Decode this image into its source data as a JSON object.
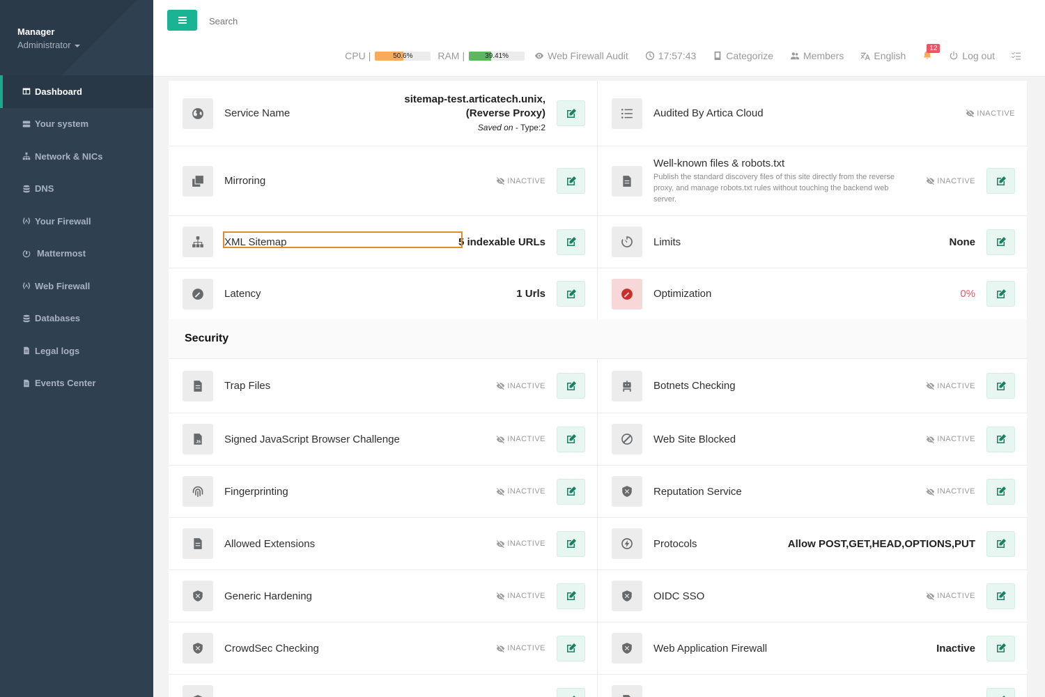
{
  "sidebar": {
    "user_name": "Manager",
    "user_role": "Administrator",
    "items": [
      {
        "label": "Dashboard",
        "icon": "dashboard-icon"
      },
      {
        "label": "Your system",
        "icon": "server-icon"
      },
      {
        "label": "Network & NICs",
        "icon": "network-icon"
      },
      {
        "label": "DNS",
        "icon": "database-icon"
      },
      {
        "label": "Your Firewall",
        "icon": "firewall-icon"
      },
      {
        "label": "Mattermost",
        "icon": "mattermost-icon"
      },
      {
        "label": "Web Firewall",
        "icon": "firewall-icon"
      },
      {
        "label": "Databases",
        "icon": "database-icon"
      },
      {
        "label": "Legal logs",
        "icon": "file-icon"
      },
      {
        "label": "Events Center",
        "icon": "file-icon"
      }
    ]
  },
  "header": {
    "search_placeholder": "Search",
    "cpu_label": "CPU",
    "cpu_sep": "|",
    "cpu_value": "50.6%",
    "cpu_percent": 50.6,
    "cpu_color": "#f8ac59",
    "ram_label": "RAM",
    "ram_sep": "|",
    "ram_value": "39.41%",
    "ram_percent": 39.41,
    "ram_color": "#5cb85c",
    "audit": "Web Firewall Audit",
    "clock": "17:57:43",
    "categorize": "Categorize",
    "members": "Members",
    "language": "English",
    "notifications": "12",
    "logout": "Log out"
  },
  "service": {
    "name_label": "Service Name",
    "name_value": "sitemap-test.articatech.unix, (Reverse Proxy)",
    "saved_on": "Saved on",
    "saved_type": " - Type:2",
    "audited_label": "Audited By Artica Cloud",
    "mirroring_label": "Mirroring",
    "wellknown_label": "Well-known files & robots.txt",
    "wellknown_desc": "Publish the standard discovery files of this site directly from the reverse proxy, and manage robots.txt rules without touching the backend web server.",
    "sitemap_label": "XML Sitemap",
    "sitemap_value": "5 indexable URLs",
    "limits_label": "Limits",
    "limits_value": "None",
    "latency_label": "Latency",
    "latency_value": "1 Urls",
    "optimization_label": "Optimization",
    "optimization_value": "0%"
  },
  "inactive_text": "INACTIVE",
  "security": {
    "title": "Security",
    "rows": [
      {
        "left": "Trap Files",
        "right": "Botnets Checking",
        "right_value": ""
      },
      {
        "left": "Signed JavaScript Browser Challenge",
        "right": "Web Site Blocked",
        "right_value": ""
      },
      {
        "left": "Fingerprinting",
        "right": "Reputation Service",
        "right_value": ""
      },
      {
        "left": "Allowed Extensions",
        "right": "Protocols",
        "right_value": "Allow POST,GET,HEAD,OPTIONS,PUT"
      },
      {
        "left": "Generic Hardening",
        "right": "OIDC SSO",
        "right_value": ""
      },
      {
        "left": "CrowdSec Checking",
        "right": "Web Application Firewall",
        "right_value": "Inactive"
      }
    ]
  }
}
